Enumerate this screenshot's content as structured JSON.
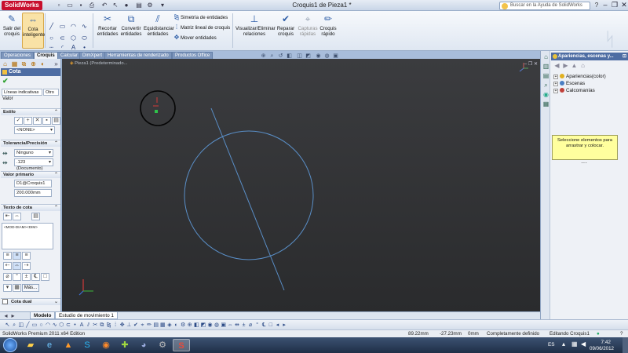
{
  "app": {
    "logo_text": "SolidWorks",
    "document_title": "Croquis1 de Pieza1 *",
    "help_search_placeholder": "Buscar en la Ayuda de SolidWorks"
  },
  "ribbon": {
    "exit_sketch": [
      "Salir del",
      "croquis"
    ],
    "smart_dimension": [
      "Cota",
      "inteligente"
    ],
    "trim": [
      "Recortar",
      "entidades"
    ],
    "convert": [
      "Convertir",
      "entidades"
    ],
    "offset": [
      "Equidistanciar",
      "entidades"
    ],
    "mirror": "Simetría de entidades",
    "linear_pattern": "Matriz lineal de croquis",
    "move": "Mover entidades",
    "display_delete": [
      "Visualizar/Eliminar",
      "relaciones"
    ],
    "repair": [
      "Reparar",
      "croquis"
    ],
    "quick_snaps": [
      "Capturas",
      "rápidas"
    ],
    "rapid_sketch": [
      "Croquis",
      "rápido"
    ]
  },
  "tabs": [
    "Operaciones",
    "Croquis",
    "Calcular",
    "DimXpert",
    "Herramientas de renderizado",
    "Productos Office"
  ],
  "active_tab": "Croquis",
  "left_panel": {
    "title": "Cota",
    "subtabs": [
      "Líneas indicativas",
      "Otro"
    ],
    "value_label": "Valor",
    "style_label": "Estilo",
    "style_value": "<NONE>",
    "tolerance_label": "Tolerancia/Precisión",
    "tolerance_value": "Ninguno",
    "precision_value": ".123 (Documento)",
    "primary_value_label": "Valor primario",
    "dim_name": "D1@Croquis1",
    "dim_value": "200.000mm",
    "text_label": "Texto de cota",
    "text_value": "<MOD-DIAM><DIM>",
    "more_button": "Más...",
    "dual_label": "Cota dual"
  },
  "viewport": {
    "breadcrumb": "Pieza1 (Predeterminado..."
  },
  "model_tabs": [
    "Modelo",
    "Estudio de movimiento 1"
  ],
  "active_model_tab": "Modelo",
  "status": {
    "edition": "SolidWorks Premium 2011 x64 Edition",
    "x": "89.22mm",
    "y": "-27.23mm",
    "z": "0mm",
    "state": "Completamente definido",
    "editing": "Editando Croquis1"
  },
  "right_panel": {
    "title": "Apariencias, escenas y...",
    "items": [
      "Apariencias(color)",
      "Escenas",
      "Calcomanías"
    ],
    "tooltip": [
      "Seleccione elementos para",
      "arrastrar y colocar."
    ]
  },
  "taskbar": {
    "language": "ES",
    "time": "7:42",
    "date": "09/06/2012"
  },
  "colors": {
    "viewport_bg": "#2f3033",
    "sketch_line": "#5a8fc8",
    "accent": "#4e6da3"
  }
}
